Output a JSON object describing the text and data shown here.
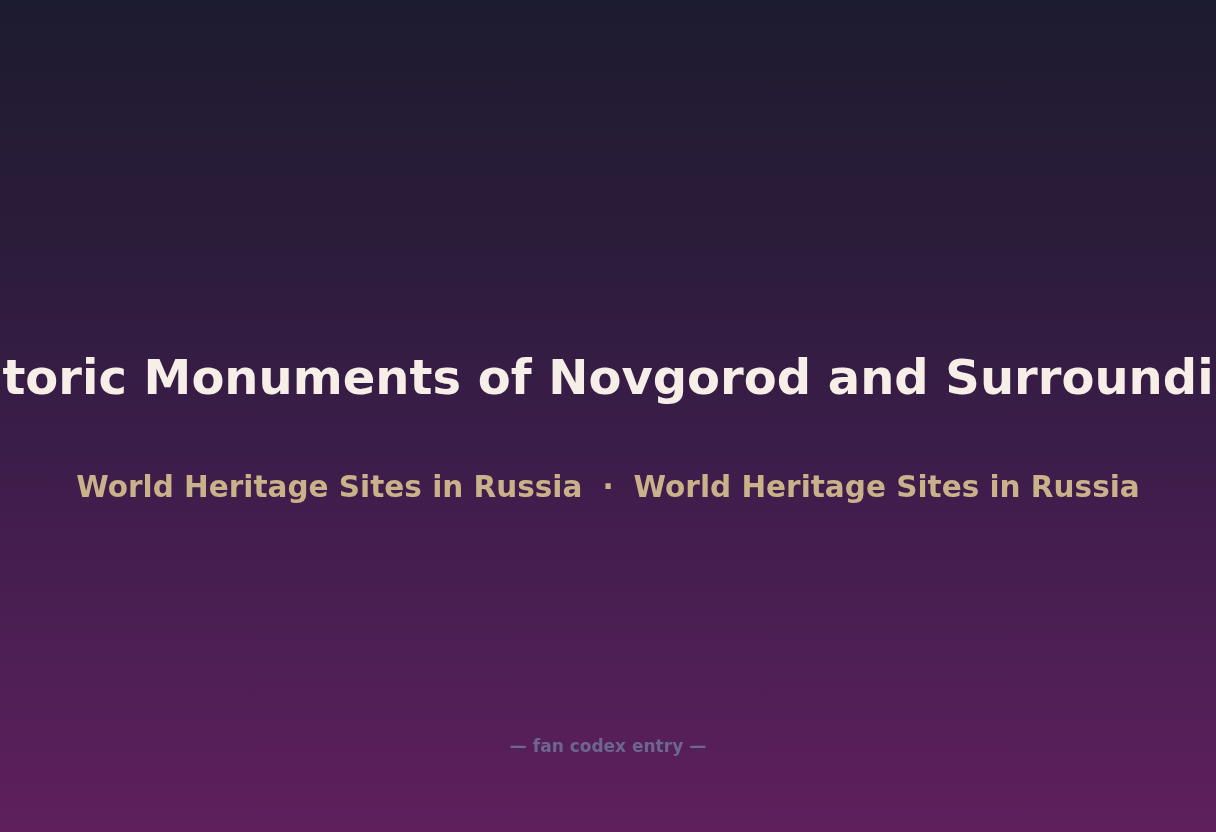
{
  "title": "toric Monuments of Novgorod and Surroundi",
  "subtitle": {
    "parts": [
      "World Heritage Sites in Russia",
      "World Heritage Sites in Russia"
    ],
    "separator": "·"
  },
  "footer": "— fan codex entry —"
}
